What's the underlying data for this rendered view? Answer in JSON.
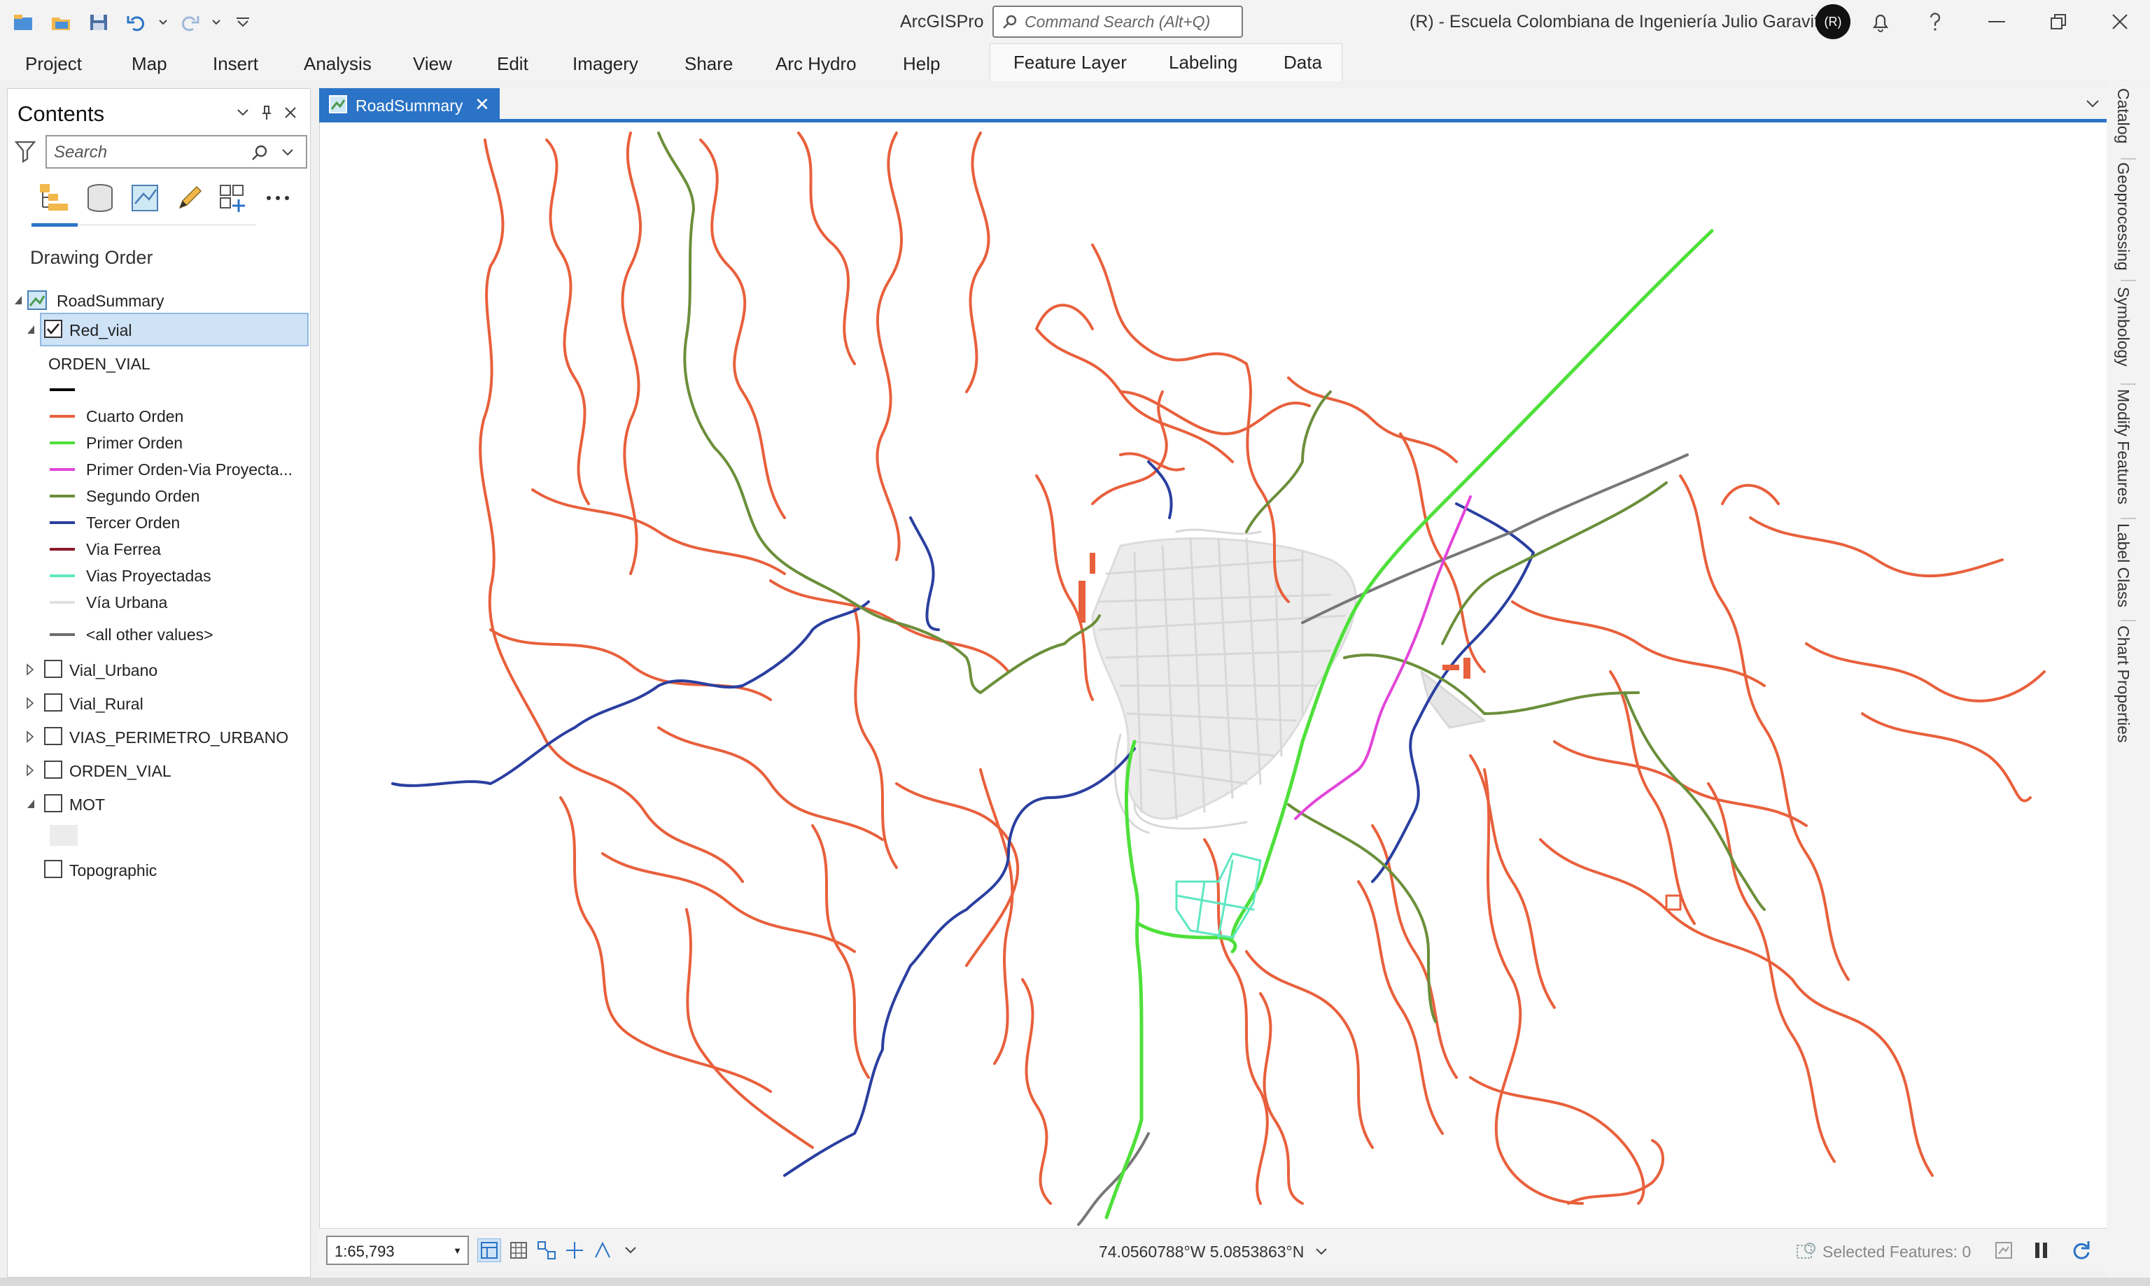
{
  "window": {
    "app_title": "ArcGISPro",
    "command_search_placeholder": "Command Search (Alt+Q)",
    "org": "(R) - Escuela Colombiana de Ingeniería Julio Garavito",
    "avatar_initials": "(R)"
  },
  "ribbon": {
    "tabs": [
      "Project",
      "Map",
      "Insert",
      "Analysis",
      "View",
      "Edit",
      "Imagery",
      "Share",
      "Arc Hydro",
      "Help"
    ],
    "context_tabs": [
      "Feature Layer",
      "Labeling",
      "Data"
    ]
  },
  "contents": {
    "title": "Contents",
    "search_placeholder": "Search",
    "section": "Drawing Order",
    "map_name": "RoadSummary",
    "selected_layer": "Red_vial",
    "field_heading": "ORDEN_VIAL",
    "legend": [
      {
        "label": "",
        "color": "#000000"
      },
      {
        "label": "Cuarto Orden",
        "color": "#e8603c"
      },
      {
        "label": "Primer Orden",
        "color": "#4ee03a"
      },
      {
        "label": "Primer Orden-Via Proyecta...",
        "color": "#e245d8"
      },
      {
        "label": "Segundo Orden",
        "color": "#6b8f3a"
      },
      {
        "label": "Tercer Orden",
        "color": "#2a3fa0"
      },
      {
        "label": "Via Ferrea",
        "color": "#8b1a2a"
      },
      {
        "label": "Vias Proyectadas",
        "color": "#5de8c0"
      },
      {
        "label": "Vía Urbana",
        "color": "#e0e0e0"
      },
      {
        "label": "<all other values>",
        "color": "#6e6e6e"
      }
    ],
    "layers": [
      "Vial_Urbano",
      "Vial_Rural",
      "VIAS_PERIMETRO_URBANO",
      "ORDEN_VIAL",
      "MOT"
    ],
    "topographic": "Topographic"
  },
  "map": {
    "tab_name": "RoadSummary",
    "colors": {
      "cuarto": "#e8603c",
      "primer": "#4ee03a",
      "primer_proy": "#e245d8",
      "segundo": "#6b8f3a",
      "tercer": "#2a3fa0",
      "proyectadas": "#5de8c0",
      "urbana": "#d8d8d8",
      "other": "#777777"
    }
  },
  "status": {
    "scale": "1:65,793",
    "coordinates": "74.0560788°W 5.0853863°N",
    "selected_features": "Selected Features: 0"
  },
  "dock": [
    "Catalog",
    "Geoprocessing",
    "Symbology",
    "Modify Features",
    "Label Class",
    "Chart Properties"
  ]
}
